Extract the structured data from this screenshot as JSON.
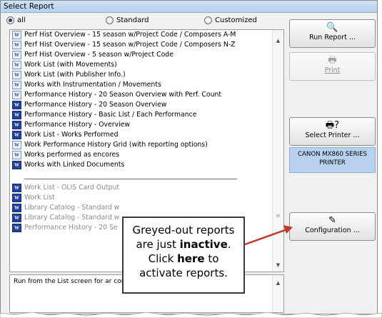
{
  "window": {
    "title": "Select Report"
  },
  "filter": {
    "options": [
      {
        "label": "all",
        "selected": true
      },
      {
        "label": "Standard",
        "selected": false
      },
      {
        "label": "Customized",
        "selected": false
      }
    ]
  },
  "report_list": {
    "active_items": [
      {
        "label": "Perf Hist Overview - 15 season w/Project Code / Composers A-M",
        "icon": "w-light"
      },
      {
        "label": "Perf Hist Overview - 15 season w/Project Code / Composers N-Z",
        "icon": "w-light"
      },
      {
        "label": "Perf Hist Overview - 5 season w/Project Code",
        "icon": "w-light"
      },
      {
        "label": "Work List (with Movements)",
        "icon": "w-light"
      },
      {
        "label": "Work List (with Publisher Info.)",
        "icon": "w-light"
      },
      {
        "label": "Works with Instrumentation / Movements",
        "icon": "w-light"
      },
      {
        "label": "Performance History - 20 Season Overview with Perf. Count",
        "icon": "w-light"
      },
      {
        "label": "Performance History - 20 Season Overview",
        "icon": "w-dark"
      },
      {
        "label": "Performance History - Basic List / Each Performance",
        "icon": "w-dark"
      },
      {
        "label": "Performance History - Overview",
        "icon": "w-dark"
      },
      {
        "label": "Work List - Works Performed",
        "icon": "w-dark"
      },
      {
        "label": "Work Performance History Grid (with reporting options)",
        "icon": "w-light"
      },
      {
        "label": "Works performed as encores",
        "icon": "w-light"
      },
      {
        "label": "Works with Linked Documents",
        "icon": "w-dark"
      }
    ],
    "inactive_items": [
      {
        "label": "Work List - OLIS Card Output",
        "icon": "w-dark"
      },
      {
        "label": "Work List",
        "icon": "w-dark"
      },
      {
        "label": "Library Catalog - Standard w",
        "icon": "w-dark"
      },
      {
        "label": "Library Catalog - Standard w",
        "icon": "w-dark"
      },
      {
        "label": "Performance History - 20 Se",
        "icon": "w-dark"
      }
    ]
  },
  "description": {
    "text": "Run from the List screen for ar compositions"
  },
  "buttons": {
    "run_report": "Run Report ...",
    "print": "Print",
    "select_printer": "Select Printer ...",
    "configuration": "Configuration ..."
  },
  "printer": {
    "name": "CANON MX860 SERIES PRINTER"
  },
  "callout": {
    "line1": "Greyed-out reports",
    "line2_pre": "are just ",
    "line2_bold": "inactive",
    "line2_post": ".",
    "line3_pre": "Click ",
    "line3_bold": "here",
    "line3_post": " to",
    "line4": "activate reports."
  },
  "icons": {
    "report": "word-document-icon",
    "run": "magnifier-page-icon",
    "print": "printer-icon",
    "select_printer": "printer-question-icon",
    "configuration": "edit-page-icon"
  },
  "colors": {
    "title_bar": "#b6d0ee",
    "printer_highlight": "#b7d1ee",
    "arrow": "#c0392b"
  }
}
